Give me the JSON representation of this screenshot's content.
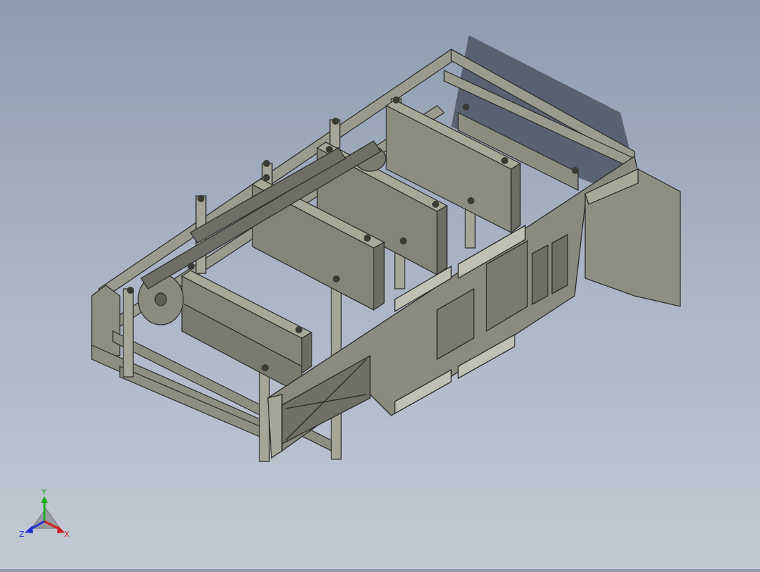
{
  "triad": {
    "x_label": "X",
    "y_label": "Y",
    "z_label": "Z",
    "x_color": "#d02020",
    "y_color": "#20b020",
    "z_color": "#2030d0"
  },
  "colors": {
    "panel": "#8a8a80",
    "panel_dark": "#5f5f58",
    "panel_light": "#a6a698",
    "edge": "#2a2a28",
    "shadow": "#4a5260"
  }
}
